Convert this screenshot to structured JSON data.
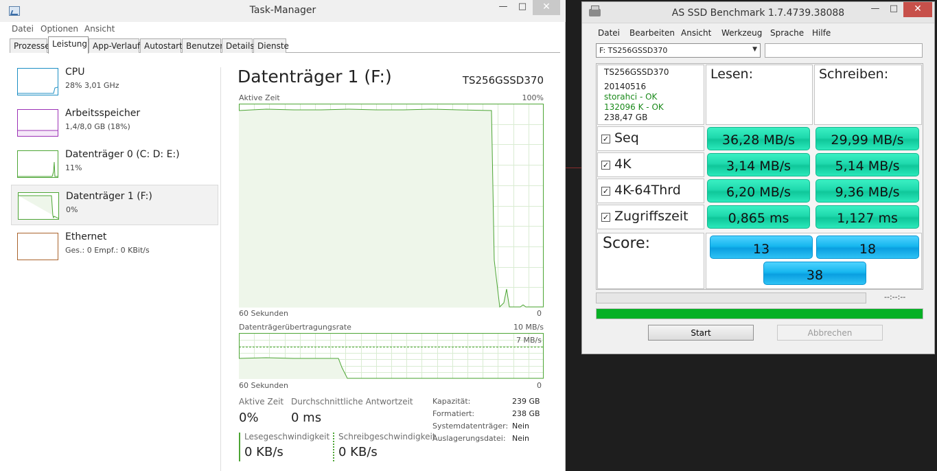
{
  "task_manager": {
    "title": "Task-Manager",
    "menu": [
      "Datei",
      "Optionen",
      "Ansicht"
    ],
    "tabs": [
      "Prozesse",
      "Leistung",
      "App-Verlauf",
      "Autostart",
      "Benutzer",
      "Details",
      "Dienste"
    ],
    "active_tab": "Leistung",
    "sidebar": [
      {
        "name": "CPU",
        "value": "28% 3,01 GHz",
        "color": "#1b8ec3"
      },
      {
        "name": "Arbeitsspeicher",
        "value": "1,4/8,0 GB (18%)",
        "color": "#9b30b5"
      },
      {
        "name": "Datenträger 0 (C: D: E:)",
        "value": "11%",
        "color": "#4ca534"
      },
      {
        "name": "Datenträger 1 (F:)",
        "value": "0%",
        "color": "#4ca534",
        "selected": true
      },
      {
        "name": "Ethernet",
        "value_parts": [
          "Ges.:",
          "0",
          "Empf.:",
          "0 KBit/s"
        ],
        "color": "#a9622b"
      }
    ],
    "detail": {
      "title": "Datenträger 1 (F:)",
      "model": "TS256GSSD370",
      "chart1": {
        "label": "Aktive Zeit",
        "max_label": "100%",
        "x_label": "60 Sekunden",
        "x_end": "0"
      },
      "chart2": {
        "label": "Datenträgerübertragungsrate",
        "max_label": "10 MB/s",
        "inner_label": "7 MB/s",
        "x_label": "60 Sekunden",
        "x_end": "0"
      },
      "stats": {
        "active_time_label": "Aktive Zeit",
        "active_time_value": "0%",
        "response_label": "Durchschnittliche Antwortzeit",
        "response_value": "0 ms",
        "read_label": "Lesegeschwindigkeit",
        "read_value": "0 KB/s",
        "write_label": "Schreibgeschwindigkeit",
        "write_value": "0 KB/s"
      },
      "properties": [
        {
          "label": "Kapazität:",
          "value": "239 GB"
        },
        {
          "label": "Formatiert:",
          "value": "238 GB"
        },
        {
          "label": "Systemdatenträger:",
          "value": "Nein"
        },
        {
          "label": "Auslagerungsdatei:",
          "value": "Nein"
        }
      ]
    },
    "colors": {
      "disk_green": "#4ca534",
      "disk_fill": "#eef6ea"
    }
  },
  "as_ssd": {
    "title": "AS SSD Benchmark 1.7.4739.38088",
    "menu": [
      "Datei",
      "Bearbeiten",
      "Ansicht",
      "Werkzeug",
      "Sprache",
      "Hilfe"
    ],
    "drive_select": "F: TS256GSSD370",
    "info": {
      "model": "TS256GSSD370",
      "firmware": "20140516",
      "driver": "storahci - OK",
      "alignment": "132096 K - OK",
      "size": "238,47 GB"
    },
    "read_header": "Lesen:",
    "write_header": "Schreiben:",
    "rows": [
      {
        "label": "Seq",
        "read": "36,28 MB/s",
        "write": "29,99 MB/s",
        "checked": true
      },
      {
        "label": "4K",
        "read": "3,14 MB/s",
        "write": "5,14 MB/s",
        "checked": true
      },
      {
        "label": "4K-64Thrd",
        "read": "6,20 MB/s",
        "write": "9,36 MB/s",
        "checked": true
      },
      {
        "label": "Zugriffszeit",
        "read": "0,865 ms",
        "write": "1,127 ms",
        "checked": true
      }
    ],
    "score_label": "Score:",
    "score_read": "13",
    "score_write": "18",
    "score_total": "38",
    "time_display": "--:--:--",
    "progress_fraction": 1.0,
    "start_label": "Start",
    "abort_label": "Abbrechen"
  }
}
